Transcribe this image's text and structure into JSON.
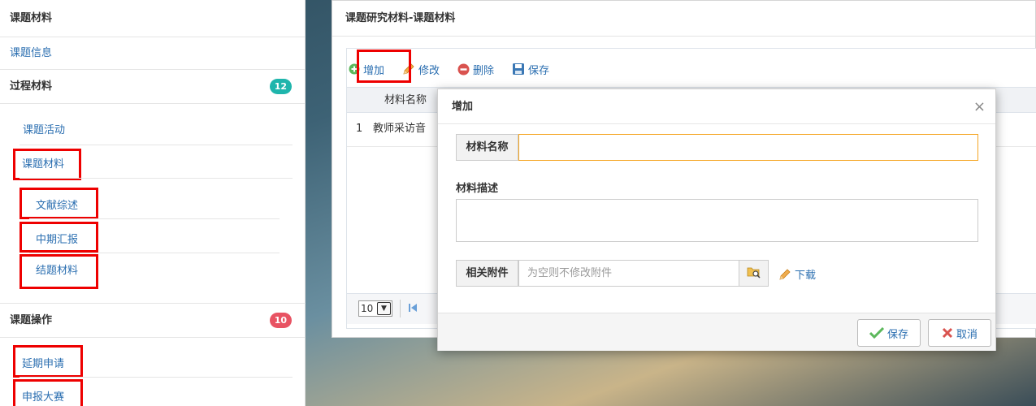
{
  "sidebar": {
    "header": "课题材料",
    "info_link": "课题信息",
    "process_group": {
      "label": "过程材料",
      "badge": "12"
    },
    "items": {
      "activity": "课题活动",
      "material": "课题材料",
      "literature": "文献综述",
      "midterm": "中期汇报",
      "final": "结题材料"
    },
    "ops_group": {
      "label": "课题操作",
      "badge": "10"
    },
    "ops_items": {
      "extension": "延期申请",
      "contest": "申报大赛"
    }
  },
  "panel": {
    "title": "课题研究材料-课题材料",
    "toolbar": {
      "add": "增加",
      "edit": "修改",
      "delete": "删除",
      "save": "保存"
    },
    "grid": {
      "columns": [
        "材料名称"
      ],
      "rows": [
        {
          "index": "1",
          "name": "教师采访音"
        }
      ]
    },
    "pager": {
      "page_size": "10"
    }
  },
  "dialog": {
    "title": "增加",
    "close": "×",
    "fields": {
      "name_label": "材料名称",
      "name_value": "",
      "desc_label": "材料描述",
      "desc_value": "",
      "attach_label": "相关附件",
      "attach_placeholder": "为空则不修改附件",
      "download": "下载"
    },
    "buttons": {
      "save": "保存",
      "cancel": "取消"
    }
  },
  "colors": {
    "link": "#2a6eb0",
    "highlight": "#ee0000",
    "badge_teal": "#1fb5ac",
    "badge_red": "#e85363",
    "focus": "#f5a623"
  }
}
